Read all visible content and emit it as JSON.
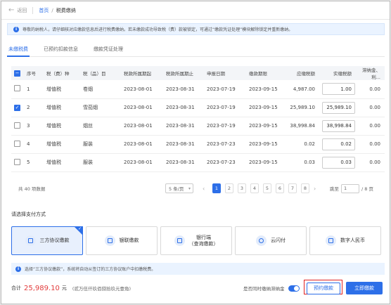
{
  "nav": {
    "back_label": "返回",
    "breadcrumb": [
      "首页",
      "税费缴纳"
    ]
  },
  "notice": "尊敬的纳税人，请仔细核对应缴款信息后进行税费缴纳。若未缴款成功导致税（费）款被锁定，可通过“缴款凭证处理”模块解除锁定并重新缴纳。",
  "tabs": [
    "未缴税费",
    "已预约扣款信息",
    "缴款凭证处理"
  ],
  "active_tab": 0,
  "table": {
    "headers": [
      "序号",
      "税（费）种",
      "税（品）目",
      "税款所属期起",
      "税款所属期止",
      "申报日期",
      "缴款期限",
      "应缴税额",
      "实缴税额",
      "滞纳金、利..."
    ],
    "rows": [
      {
        "checked": false,
        "no": "1",
        "tax": "增值税",
        "item": "卷烟",
        "start": "2023-08-01",
        "end": "2023-08-31",
        "decl": "2023-07-19",
        "due": "2023-09-15",
        "payable": "4,987.00",
        "paid": "1.00",
        "late": "0.00"
      },
      {
        "checked": true,
        "no": "2",
        "tax": "增值税",
        "item": "雪茄烟",
        "start": "2023-08-01",
        "end": "2023-08-31",
        "decl": "2023-07-19",
        "due": "2023-09-15",
        "payable": "25,989.10",
        "paid": "25,989.10",
        "late": "0.00"
      },
      {
        "checked": false,
        "no": "3",
        "tax": "增值税",
        "item": "烟丝",
        "start": "2023-08-01",
        "end": "2023-08-31",
        "decl": "2023-07-19",
        "due": "2023-09-15",
        "payable": "38,998.84",
        "paid": "38,998.84",
        "late": "0.00"
      },
      {
        "checked": false,
        "no": "4",
        "tax": "增值税",
        "item": "服装",
        "start": "2023-08-01",
        "end": "2023-08-31",
        "decl": "2023-07-23",
        "due": "2023-09-15",
        "payable": "0.02",
        "paid": "0.02",
        "late": "0.00"
      },
      {
        "checked": false,
        "no": "5",
        "tax": "增值税",
        "item": "服装",
        "start": "2023-08-01",
        "end": "2023-08-31",
        "decl": "2023-07-23",
        "due": "2023-09-15",
        "payable": "0.03",
        "paid": "0.03",
        "late": "0.00"
      }
    ]
  },
  "pager": {
    "total": "共 40 项数据",
    "page_size": "5 条/页",
    "pages": [
      "1",
      "2",
      "3",
      "4",
      "5",
      "6",
      "7",
      "8"
    ],
    "current": "1",
    "jump_label": "跳至",
    "jump_value": "1",
    "page_total": "/ 8 页"
  },
  "payment": {
    "label": "请选择支付方式",
    "methods": [
      {
        "name": "三方协议缴款",
        "selected": true
      },
      {
        "name": "银联缴款",
        "selected": false
      },
      {
        "name": "银行端\n（查询缴款）",
        "selected": false
      },
      {
        "name": "云闪付",
        "selected": false
      },
      {
        "name": "数字人民币",
        "selected": false
      }
    ],
    "note": "选择“三方协议缴款”，系统将自动从签订的三方协议账户中扣缴税费。"
  },
  "footer": {
    "total_label": "合计",
    "total_amount": "25,989.10",
    "unit": "元",
    "amount_cn": "(贰万伍仟玖佰捌拾玖元壹角)",
    "toggle_label": "是否同时缴纳滞纳金",
    "toggle_on": true,
    "schedule_button": "预约缴款",
    "pay_button": "立即缴款"
  },
  "colors": {
    "accent": "#2d6fe8",
    "total": "#e23c3c",
    "highlight_box": "#e02020"
  }
}
